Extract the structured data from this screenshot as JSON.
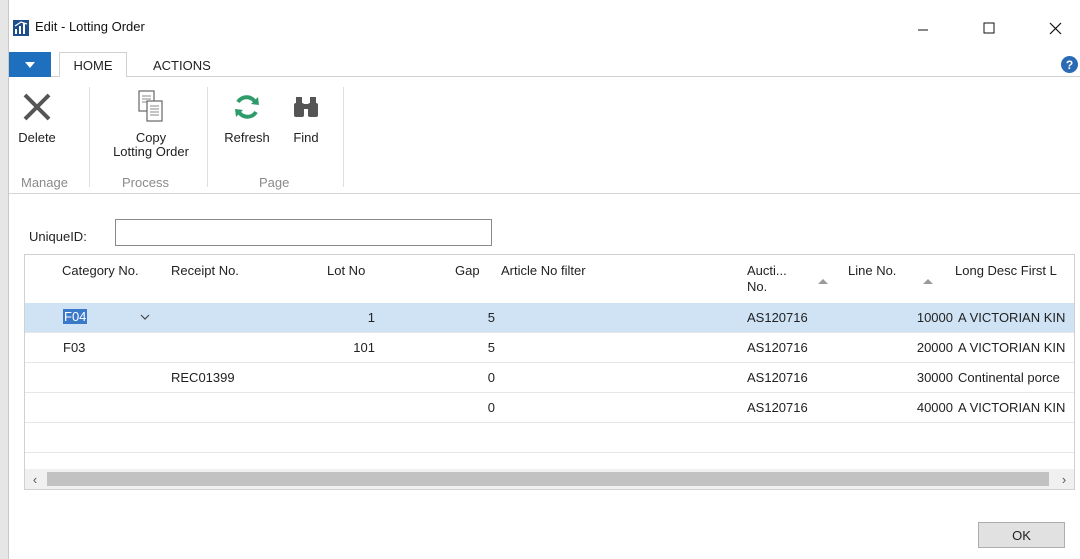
{
  "window": {
    "title": "Edit - Lotting Order"
  },
  "tabs": [
    {
      "label": "HOME",
      "active": true
    },
    {
      "label": "ACTIONS",
      "active": false
    }
  ],
  "ribbon": {
    "buttons": {
      "delete": "Delete",
      "copy_line1": "Copy",
      "copy_line2": "Lotting Order",
      "refresh": "Refresh",
      "find": "Find"
    },
    "groups": {
      "manage": "Manage",
      "process": "Process",
      "page": "Page"
    }
  },
  "form": {
    "unique_id_label": "UniqueID:",
    "unique_id_value": ""
  },
  "grid": {
    "headers": {
      "category": "Category No.",
      "receipt": "Receipt No.",
      "lot": "Lot No",
      "gap": "Gap",
      "article": "Article No filter",
      "auction_line1": "Aucti...",
      "auction_line2": "No.",
      "line": "Line No.",
      "long_desc": "Long Desc First L"
    },
    "rows": [
      {
        "category": "F04",
        "receipt": "",
        "lot": "1",
        "gap": "5",
        "article": "",
        "auction": "AS120716",
        "line": "10000",
        "long_desc": "A VICTORIAN KIN"
      },
      {
        "category": "F03",
        "receipt": "",
        "lot": "101",
        "gap": "5",
        "article": "",
        "auction": "AS120716",
        "line": "20000",
        "long_desc": "A VICTORIAN KIN"
      },
      {
        "category": "",
        "receipt": "REC01399",
        "lot": "",
        "gap": "0",
        "article": "",
        "auction": "AS120716",
        "line": "30000",
        "long_desc": "Continental porce"
      },
      {
        "category": "",
        "receipt": "",
        "lot": "",
        "gap": "0",
        "article": "",
        "auction": "AS120716",
        "line": "40000",
        "long_desc": "A VICTORIAN KIN"
      }
    ]
  },
  "footer": {
    "ok_label": "OK"
  },
  "colors": {
    "accent": "#1f6fbf",
    "selection": "#cfe3f5",
    "refresh_green": "#2e9c6a"
  }
}
